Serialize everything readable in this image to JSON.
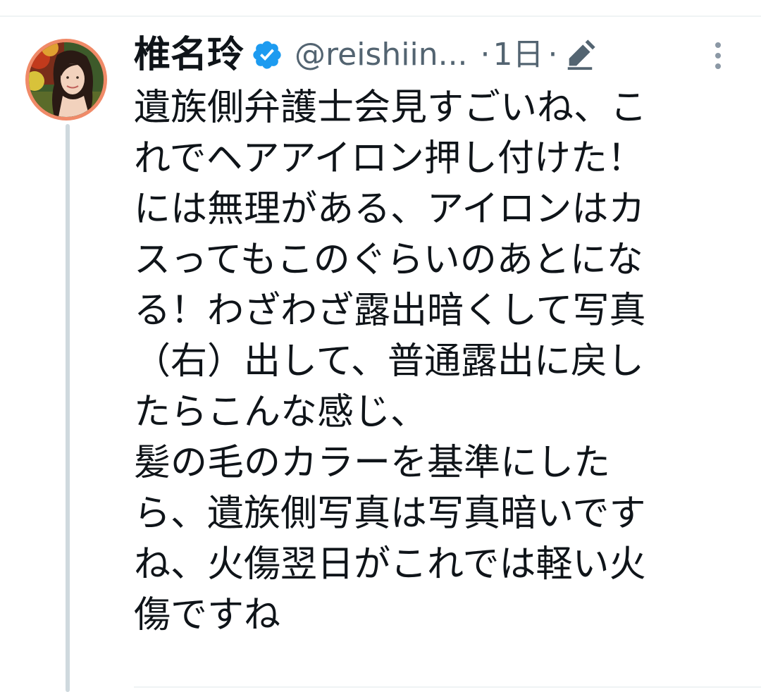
{
  "tweet": {
    "author_name": "椎名玲",
    "handle": "@reishiin...",
    "separator": "·",
    "time": "1日",
    "separator2": "·",
    "lines": [
      "遺族側弁護士会見すごいね、こ",
      "れでヘアアイロン押し付けた！",
      "には無理がある、アイロンはカ",
      "スってもこのぐらいのあとにな",
      "る！わざわざ露出暗くして写真",
      "（右）出して、普通露出に戻し",
      "たらこんな感じ、",
      "髪の毛のカラーを基準にした",
      "ら、遺族側写真は写真暗いです",
      "ね、火傷翌日がこれでは軽い火",
      "傷ですね"
    ]
  },
  "icons": {
    "verified": "verified-badge-icon",
    "edit": "pencil-icon",
    "more": "more-vertical-icon"
  },
  "colors": {
    "verified": "#1d9bf0",
    "secondary_text": "#536471",
    "avatar_ring": "#f08a68",
    "thread_line": "#cfd9de"
  }
}
